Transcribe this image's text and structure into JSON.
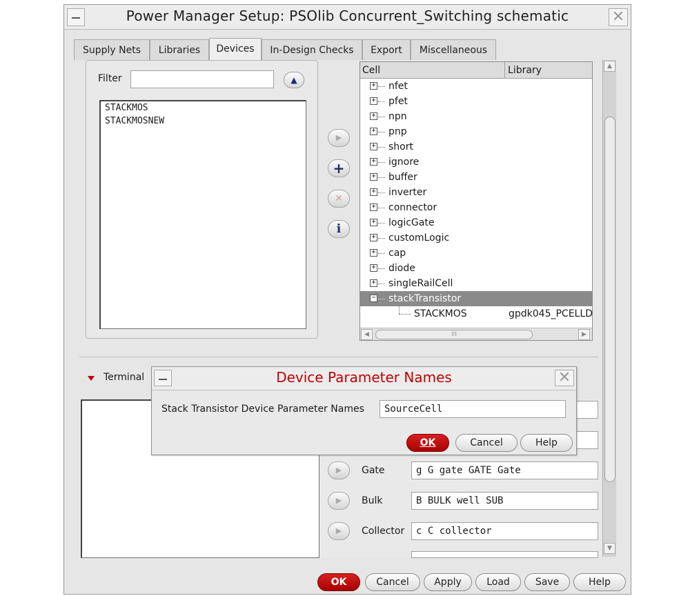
{
  "window": {
    "title": "Power Manager Setup: PSOlib Concurrent_Switching schematic"
  },
  "tabs": [
    {
      "label": "Supply Nets"
    },
    {
      "label": "Libraries"
    },
    {
      "label": "Devices",
      "active": true
    },
    {
      "label": "In-Design Checks"
    },
    {
      "label": "Export"
    },
    {
      "label": "Miscellaneous"
    }
  ],
  "devices": {
    "filter_label": "Filter",
    "filter_value": "",
    "list": [
      "STACKMOS",
      "STACKMOSNEW"
    ]
  },
  "middle_buttons": {
    "arrow": "▶",
    "add": "+",
    "delete": "✕",
    "info": "i"
  },
  "tree": {
    "col_cell": "Cell",
    "col_library": "Library",
    "rows": [
      {
        "label": "nfet"
      },
      {
        "label": "pfet"
      },
      {
        "label": "npn"
      },
      {
        "label": "pnp"
      },
      {
        "label": "short"
      },
      {
        "label": "ignore"
      },
      {
        "label": "buffer"
      },
      {
        "label": "inverter"
      },
      {
        "label": "connector"
      },
      {
        "label": "logicGate"
      },
      {
        "label": "customLogic"
      },
      {
        "label": "cap"
      },
      {
        "label": "diode"
      },
      {
        "label": "singleRailCell"
      },
      {
        "label": "stackTransistor",
        "selected": true,
        "expanded": true
      }
    ],
    "child": {
      "label": "STACKMOS",
      "library": "gpdk045_PCELLD"
    },
    "scroll_glyph": "III"
  },
  "terminal": {
    "section_label": "Terminal",
    "rows": [
      {
        "label": "Gate",
        "value": "g G gate GATE Gate"
      },
      {
        "label": "Bulk",
        "value": "B BULK well SUB"
      },
      {
        "label": "Collector",
        "value": "c C collector"
      }
    ]
  },
  "dialog": {
    "title": "Device Parameter Names",
    "field_label": "Stack Transistor Device Parameter Names",
    "field_value": "SourceCell",
    "ok": "OK",
    "cancel": "Cancel",
    "help": "Help"
  },
  "footer": {
    "ok": "OK",
    "cancel": "Cancel",
    "apply": "Apply",
    "load": "Load",
    "save": "Save",
    "help": "Help"
  },
  "colors": {
    "accent_red": "#c00000",
    "selection": "#8a8a8a",
    "panel": "#e6e6e6"
  }
}
